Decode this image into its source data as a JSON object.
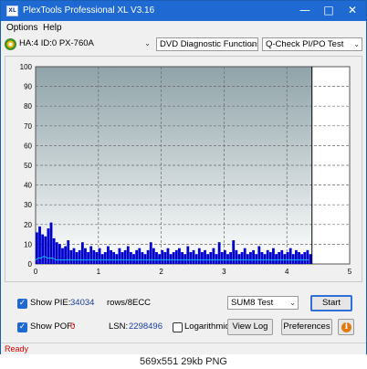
{
  "window": {
    "title": "PlexTools Professional XL V3.16",
    "app_icon_text": "XL"
  },
  "menu": [
    "Options",
    "Help"
  ],
  "toolbar": {
    "drive": "HA:4 ID:0  PX-760A",
    "function": "DVD Diagnostic Functions",
    "test": "Q-Check PI/PO Test"
  },
  "chart_data": {
    "type": "bar",
    "y_ticks": [
      "100",
      "90",
      "80",
      "70",
      "60",
      "50",
      "40",
      "30",
      "20",
      "10",
      "0"
    ],
    "x_ticks": [
      "0",
      "1",
      "2",
      "3",
      "4",
      "5"
    ],
    "xlim": [
      0,
      5
    ],
    "ylim": [
      0,
      100
    ],
    "grid": true,
    "end_marker_x": 4.4,
    "series": [
      {
        "color": "#0000cc",
        "values": [
          16,
          19,
          15,
          14,
          18,
          21,
          13,
          11,
          10,
          8,
          9,
          12,
          7,
          8,
          6,
          7,
          11,
          8,
          6,
          9,
          7,
          6,
          8,
          5,
          6,
          9,
          7,
          6,
          5,
          8,
          6,
          7,
          9,
          6,
          5,
          7,
          8,
          6,
          5,
          7,
          11,
          8,
          6,
          5,
          7,
          6,
          8,
          5,
          6,
          7,
          8,
          6,
          5,
          9,
          6,
          7,
          5,
          8,
          6,
          7,
          5,
          6,
          8,
          5,
          11,
          6,
          7,
          5,
          6,
          12,
          7,
          5,
          6,
          8,
          5,
          6,
          7,
          5,
          9,
          6,
          5,
          7,
          6,
          8,
          5,
          6,
          7,
          5,
          6,
          8,
          5,
          7,
          6,
          5,
          6,
          7,
          5
        ]
      },
      {
        "color": "#00bbff",
        "values": [
          2,
          3,
          3,
          4,
          3,
          3,
          3,
          2,
          2,
          2,
          2,
          2,
          2,
          2,
          2,
          2,
          2,
          2,
          2,
          2,
          2,
          2,
          2,
          2,
          2,
          2,
          2,
          2,
          2,
          2,
          2,
          2,
          2,
          2,
          2,
          2,
          2,
          2,
          2,
          2,
          2,
          2,
          2,
          2,
          2,
          2,
          2,
          2,
          2,
          2,
          2,
          2,
          2,
          2,
          2,
          2,
          2,
          2,
          2,
          2,
          2,
          2,
          2,
          2,
          2,
          2,
          2,
          2,
          2,
          2,
          2,
          2,
          2,
          2,
          2,
          2,
          2,
          2,
          2,
          2,
          2,
          2,
          2,
          2,
          2,
          2,
          2,
          2,
          2,
          2,
          2,
          2,
          2,
          2,
          2,
          2,
          2
        ]
      }
    ]
  },
  "controls": {
    "show_pie_label": "Show PIE:",
    "pie_value": "34034",
    "pie_unit": "rows/8ECC",
    "show_pof_label": "Show POF:",
    "pof_value": "0",
    "lsn_label": "LSN:",
    "lsn_value": "2298496",
    "logarithmic_label": "Logarithmic",
    "sum_select": "SUM8 Test",
    "start_label": "Start",
    "view_log_label": "View Log",
    "preferences_label": "Preferences",
    "info_glyph": "i"
  },
  "status": "Ready",
  "caption": "569x551  29kb  PNG"
}
